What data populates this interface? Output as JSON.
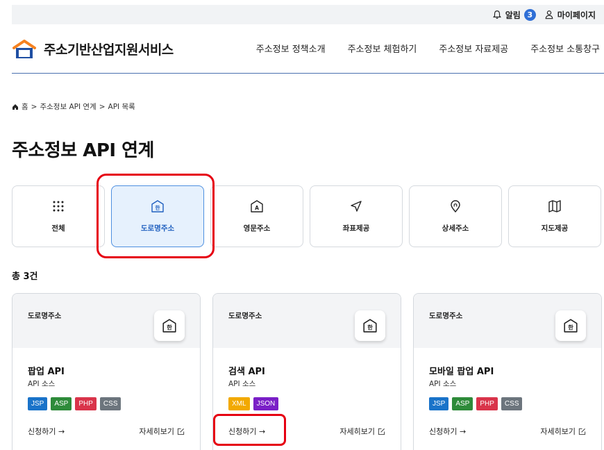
{
  "topbar": {
    "alarm_label": "알림",
    "alarm_count": "3",
    "mypage_label": "마이페이지"
  },
  "header": {
    "logo_text": "주소기반산업지원서비스",
    "nav": [
      "주소정보 정책소개",
      "주소정보 체험하기",
      "주소정보 자료제공",
      "주소정보 소통창구"
    ]
  },
  "breadcrumb": [
    "홈",
    "주소정보 API 연계",
    "API 목록"
  ],
  "page_title": "주소정보 API 연계",
  "categories": [
    {
      "label": "전체",
      "icon": "grid-icon"
    },
    {
      "label": "도로명주소",
      "icon": "road-address-icon",
      "active": true
    },
    {
      "label": "영문주소",
      "icon": "english-address-icon"
    },
    {
      "label": "좌표제공",
      "icon": "navigation-icon"
    },
    {
      "label": "상세주소",
      "icon": "location-pin-icon"
    },
    {
      "label": "지도제공",
      "icon": "map-icon"
    }
  ],
  "total": "총 3건",
  "cards": [
    {
      "category": "도로명주소",
      "name": "팝업 API",
      "subtitle": "API 소스",
      "tags": [
        "JSP",
        "ASP",
        "PHP",
        "CSS"
      ],
      "apply": "신청하기 →",
      "more": "자세히보기"
    },
    {
      "category": "도로명주소",
      "name": "검색 API",
      "subtitle": "API 소스",
      "tags": [
        "XML",
        "JSON"
      ],
      "apply": "신청하기 →",
      "more": "자세히보기"
    },
    {
      "category": "도로명주소",
      "name": "모바일 팝업 API",
      "subtitle": "API 소스",
      "tags": [
        "JSP",
        "ASP",
        "PHP",
        "CSS"
      ],
      "apply": "신청하기 →",
      "more": "자세히보기"
    }
  ],
  "colors": {
    "jsp": "#1a73c9",
    "asp": "#2e8b3a",
    "php": "#d9344a",
    "css": "#6c757d",
    "xml": "#f2a900",
    "json": "#7a1fc7",
    "accent": "#2f6fd6",
    "highlight": "#e60012"
  }
}
